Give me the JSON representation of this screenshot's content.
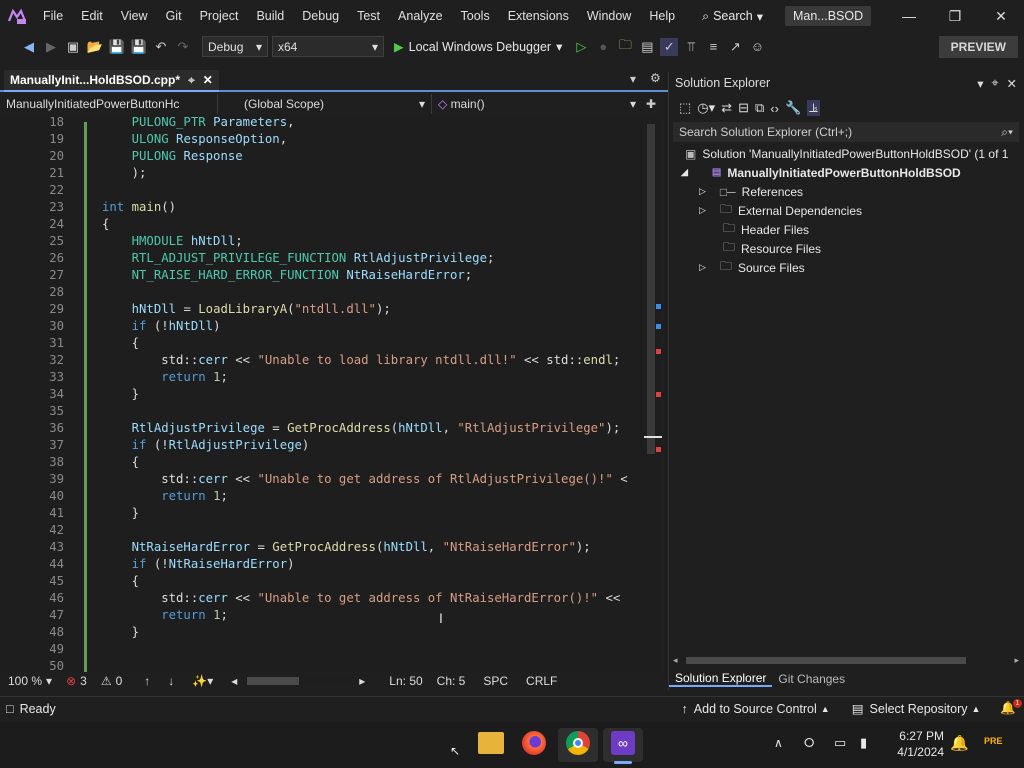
{
  "menu": [
    "File",
    "Edit",
    "View",
    "Git",
    "Project",
    "Build",
    "Debug",
    "Test",
    "Analyze",
    "Tools",
    "Extensions",
    "Window",
    "Help"
  ],
  "search_label": "Search",
  "solution_title": "Man...BSOD",
  "toolbar": {
    "config": "Debug",
    "platform": "x64",
    "run_label": "Local Windows Debugger",
    "preview_label": "PREVIEW"
  },
  "tab": {
    "title": "ManuallyInit...HoldBSOD.cpp*"
  },
  "nav": {
    "project": "ManuallyInitiatedPowerButtonHc",
    "scope": "(Global Scope)",
    "member": "main()"
  },
  "code_lines": [
    {
      "n": "18",
      "t": [
        [
          "ty",
          "    PULONG_PTR "
        ],
        [
          "var",
          "Parameters"
        ],
        [
          "plain",
          ","
        ]
      ]
    },
    {
      "n": "19",
      "t": [
        [
          "ty",
          "    ULONG "
        ],
        [
          "var",
          "ResponseOption"
        ],
        [
          "plain",
          ","
        ]
      ]
    },
    {
      "n": "20",
      "t": [
        [
          "ty",
          "    PULONG "
        ],
        [
          "var",
          "Response"
        ]
      ]
    },
    {
      "n": "21",
      "t": [
        [
          "plain",
          "    );"
        ]
      ]
    },
    {
      "n": "22",
      "t": []
    },
    {
      "n": "23",
      "t": [
        [
          "kw",
          "int "
        ],
        [
          "fn",
          "main"
        ],
        [
          "plain",
          "()"
        ]
      ]
    },
    {
      "n": "24",
      "t": [
        [
          "plain",
          "{"
        ]
      ]
    },
    {
      "n": "25",
      "t": [
        [
          "ty",
          "    HMODULE "
        ],
        [
          "var",
          "hNtDll"
        ],
        [
          "plain",
          ";"
        ]
      ]
    },
    {
      "n": "26",
      "t": [
        [
          "ty",
          "    RTL_ADJUST_PRIVILEGE_FUNCTION "
        ],
        [
          "var",
          "RtlAdjustPrivilege"
        ],
        [
          "plain",
          ";"
        ]
      ]
    },
    {
      "n": "27",
      "t": [
        [
          "ty",
          "    NT_RAISE_HARD_ERROR_FUNCTION "
        ],
        [
          "var",
          "NtRaiseHardError"
        ],
        [
          "plain",
          ";"
        ]
      ]
    },
    {
      "n": "28",
      "t": []
    },
    {
      "n": "29",
      "t": [
        [
          "var",
          "    hNtDll"
        ],
        [
          "plain",
          " = "
        ],
        [
          "fn",
          "LoadLibraryA"
        ],
        [
          "plain",
          "("
        ],
        [
          "str",
          "\"ntdll.dll\""
        ],
        [
          "plain",
          ");"
        ]
      ]
    },
    {
      "n": "30",
      "t": [
        [
          "kw",
          "    if "
        ],
        [
          "plain",
          "(!"
        ],
        [
          "var",
          "hNtDll"
        ],
        [
          "plain",
          ")"
        ]
      ]
    },
    {
      "n": "31",
      "t": [
        [
          "plain",
          "    {"
        ]
      ]
    },
    {
      "n": "32",
      "t": [
        [
          "plain",
          "        std::"
        ],
        [
          "var",
          "cerr"
        ],
        [
          "plain",
          " << "
        ],
        [
          "str",
          "\"Unable to load library ntdll.dll!\""
        ],
        [
          "plain",
          " << std::"
        ],
        [
          "fn",
          "endl"
        ],
        [
          "plain",
          ";"
        ]
      ]
    },
    {
      "n": "33",
      "t": [
        [
          "kw",
          "        return "
        ],
        [
          "num",
          "1"
        ],
        [
          "plain",
          ";"
        ]
      ]
    },
    {
      "n": "34",
      "t": [
        [
          "plain",
          "    }"
        ]
      ]
    },
    {
      "n": "35",
      "t": []
    },
    {
      "n": "36",
      "t": [
        [
          "var",
          "    RtlAdjustPrivilege"
        ],
        [
          "plain",
          " = "
        ],
        [
          "fn",
          "GetProcAddress"
        ],
        [
          "plain",
          "("
        ],
        [
          "var",
          "hNtDll"
        ],
        [
          "plain",
          ", "
        ],
        [
          "str",
          "\"RtlAdjustPrivilege\""
        ],
        [
          "plain",
          ");"
        ]
      ]
    },
    {
      "n": "37",
      "t": [
        [
          "kw",
          "    if "
        ],
        [
          "plain",
          "(!"
        ],
        [
          "var",
          "RtlAdjustPrivilege"
        ],
        [
          "plain",
          ")"
        ]
      ]
    },
    {
      "n": "38",
      "t": [
        [
          "plain",
          "    {"
        ]
      ]
    },
    {
      "n": "39",
      "t": [
        [
          "plain",
          "        std::"
        ],
        [
          "var",
          "cerr"
        ],
        [
          "plain",
          " << "
        ],
        [
          "str",
          "\"Unable to get address of RtlAdjustPrivilege()!\""
        ],
        [
          "plain",
          " <"
        ]
      ]
    },
    {
      "n": "40",
      "t": [
        [
          "kw",
          "        return "
        ],
        [
          "num",
          "1"
        ],
        [
          "plain",
          ";"
        ]
      ]
    },
    {
      "n": "41",
      "t": [
        [
          "plain",
          "    }"
        ]
      ]
    },
    {
      "n": "42",
      "t": []
    },
    {
      "n": "43",
      "t": [
        [
          "var",
          "    NtRaiseHardError"
        ],
        [
          "plain",
          " = "
        ],
        [
          "fn",
          "GetProcAddress"
        ],
        [
          "plain",
          "("
        ],
        [
          "var",
          "hNtDll"
        ],
        [
          "plain",
          ", "
        ],
        [
          "str",
          "\"NtRaiseHardError\""
        ],
        [
          "plain",
          ");"
        ]
      ]
    },
    {
      "n": "44",
      "t": [
        [
          "kw",
          "    if "
        ],
        [
          "plain",
          "(!"
        ],
        [
          "var",
          "NtRaiseHardError"
        ],
        [
          "plain",
          ")"
        ]
      ]
    },
    {
      "n": "45",
      "t": [
        [
          "plain",
          "    {"
        ]
      ]
    },
    {
      "n": "46",
      "t": [
        [
          "plain",
          "        std::"
        ],
        [
          "var",
          "cerr"
        ],
        [
          "plain",
          " << "
        ],
        [
          "str",
          "\"Unable to get address of NtRaiseHardError()!\""
        ],
        [
          "plain",
          " <<"
        ]
      ]
    },
    {
      "n": "47",
      "t": [
        [
          "kw",
          "        return "
        ],
        [
          "num",
          "1"
        ],
        [
          "plain",
          ";"
        ]
      ]
    },
    {
      "n": "48",
      "t": [
        [
          "plain",
          "    }"
        ]
      ]
    },
    {
      "n": "49",
      "t": []
    },
    {
      "n": "50",
      "t": []
    }
  ],
  "editor_status": {
    "zoom": "100 %",
    "errors": "3",
    "warnings": "0",
    "line": "Ln: 50",
    "col": "Ch: 5",
    "spacing": "SPC",
    "eol": "CRLF"
  },
  "solution_explorer": {
    "title": "Solution Explorer",
    "search_placeholder": "Search Solution Explorer (Ctrl+;)",
    "solution_label": "Solution 'ManuallyInitiatedPowerButtonHoldBSOD' (1 of 1",
    "project_label": "ManuallyInitiatedPowerButtonHoldBSOD",
    "items": [
      "References",
      "External Dependencies",
      "Header Files",
      "Resource Files",
      "Source Files"
    ],
    "tabs": [
      "Solution Explorer",
      "Git Changes"
    ]
  },
  "statusbar": {
    "ready": "Ready",
    "add_source": "Add to Source Control",
    "select_repo": "Select Repository"
  },
  "taskbar": {
    "time": "6:27 PM",
    "date": "4/1/2024"
  }
}
